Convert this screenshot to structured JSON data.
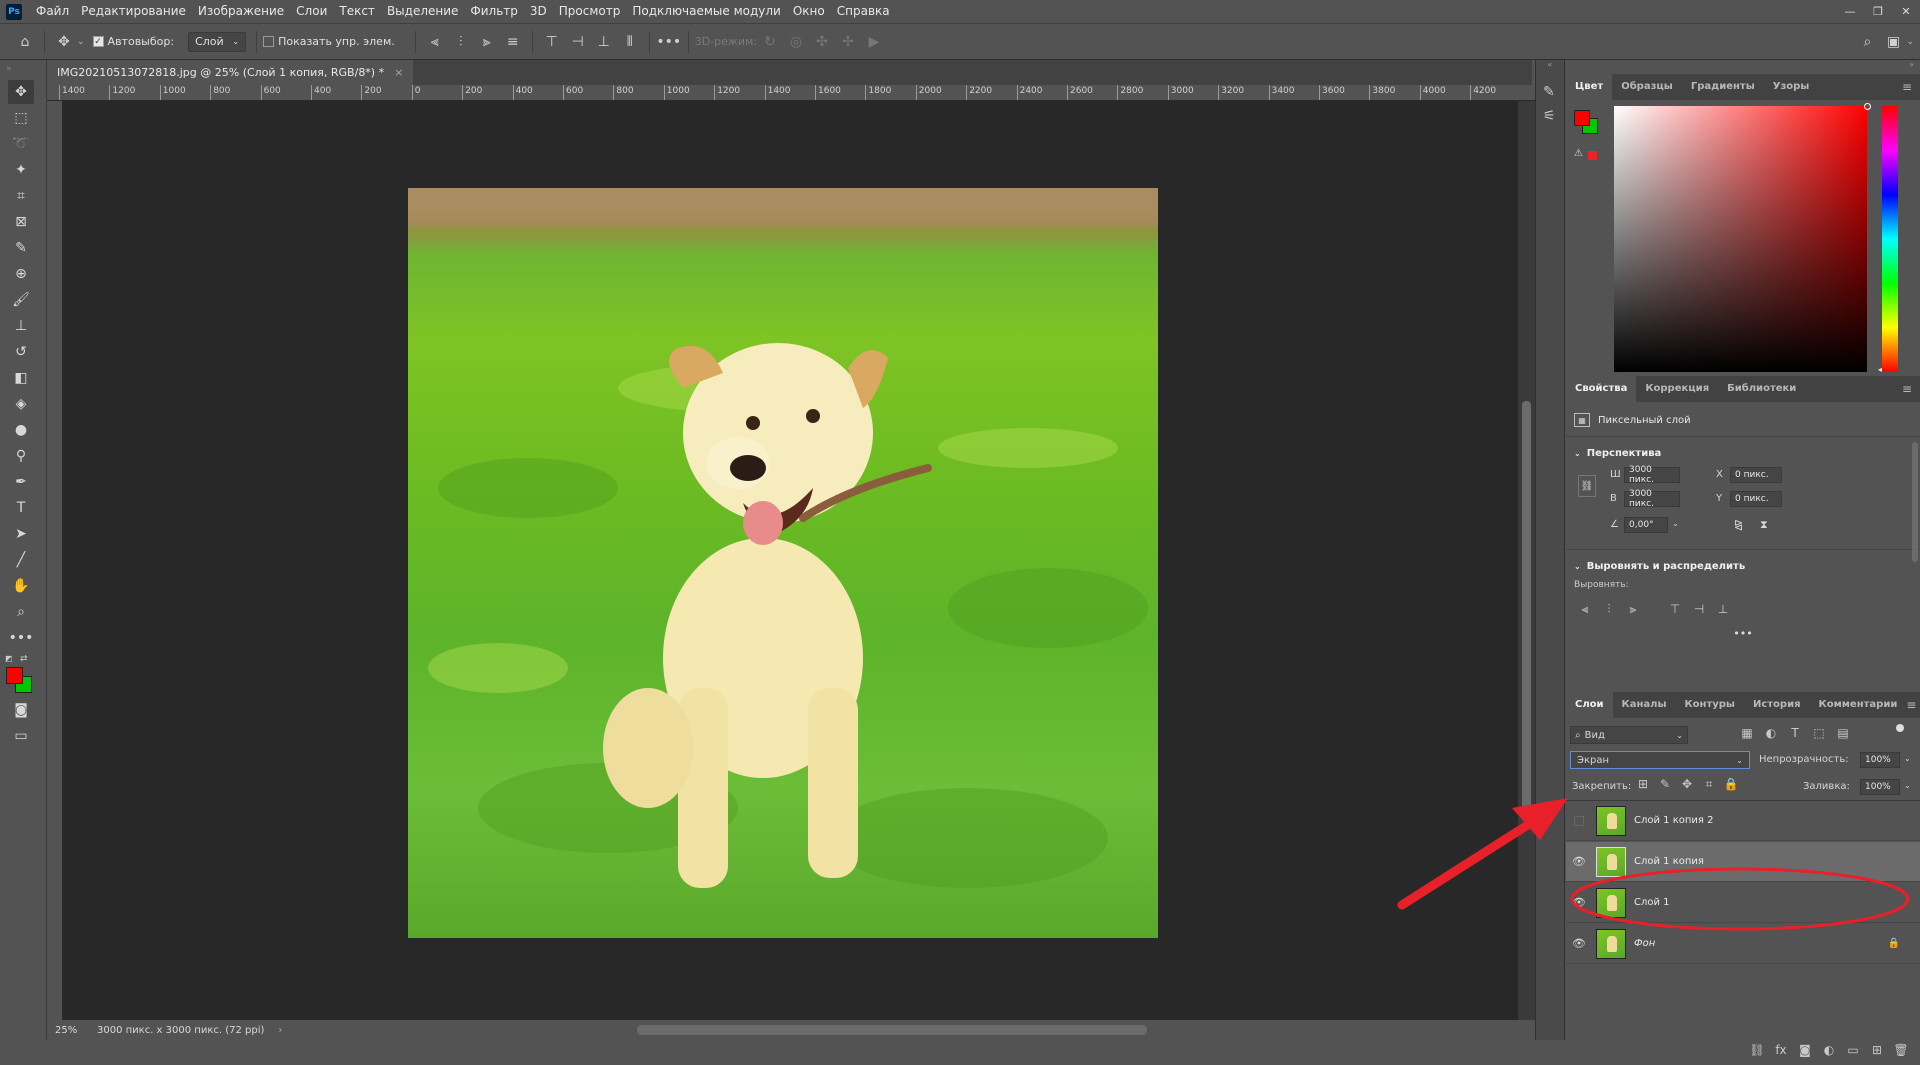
{
  "app": {
    "logo": "Ps"
  },
  "menu": [
    "Файл",
    "Редактирование",
    "Изображение",
    "Слои",
    "Текст",
    "Выделение",
    "Фильтр",
    "3D",
    "Просмотр",
    "Подключаемые модули",
    "Окно",
    "Справка"
  ],
  "window_controls": [
    "—",
    "❐",
    "✕"
  ],
  "options": {
    "autoselect_label": "Автовыбор:",
    "autoselect_value": "Слой",
    "show_transform_label": "Показать упр. элем.",
    "mode_3d": "3D-режим:"
  },
  "document": {
    "tab_title": "IMG20210513072818.jpg @ 25% (Слой 1 копия, RGB/8*) *",
    "close": "×"
  },
  "ruler_h": [
    "1400",
    "1200",
    "1000",
    "800",
    "600",
    "400",
    "200",
    "0",
    "200",
    "400",
    "600",
    "800",
    "1000",
    "1200",
    "1400",
    "1600",
    "1800",
    "2000",
    "2200",
    "2400",
    "2600",
    "2800",
    "3000",
    "3200",
    "3400",
    "3600",
    "3800",
    "4000",
    "4200"
  ],
  "status": {
    "zoom": "25%",
    "info": "3000 пикс. x 3000 пикс. (72 ppi)",
    "arrow": "›"
  },
  "color_panel": {
    "tabs": [
      "Цвет",
      "Образцы",
      "Градиенты",
      "Узоры"
    ],
    "foreground": "#ff0000",
    "background": "#00c800"
  },
  "properties_panel": {
    "tabs": [
      "Свойства",
      "Коррекция",
      "Библиотеки"
    ],
    "layer_type": "Пиксельный слой",
    "perspective_title": "Перспектива",
    "w_label": "Ш",
    "w_value": "3000 пикс.",
    "h_label": "В",
    "h_value": "3000 пикс.",
    "x_label": "X",
    "x_value": "0 пикс.",
    "y_label": "Y",
    "y_value": "0 пикс.",
    "angle_value": "0,00°",
    "align_title": "Выровнять и распределить",
    "align_label": "Выровнять:",
    "more": "•••"
  },
  "layers_panel": {
    "tabs": [
      "Слои",
      "Каналы",
      "Контуры",
      "История",
      "Комментарии"
    ],
    "filter_label": "Вид",
    "blend_mode": "Экран",
    "opacity_label": "Непрозрачность:",
    "opacity_value": "100%",
    "lock_label": "Закрепить:",
    "fill_label": "Заливка:",
    "fill_value": "100%",
    "layers": [
      {
        "name": "Слой 1 копия 2",
        "visible": false
      },
      {
        "name": "Слой 1 копия",
        "visible": true,
        "selected": true
      },
      {
        "name": "Слой 1",
        "visible": true
      },
      {
        "name": "Фон",
        "visible": true,
        "locked": true
      }
    ]
  },
  "annotation": {
    "color": "#e8202a"
  }
}
